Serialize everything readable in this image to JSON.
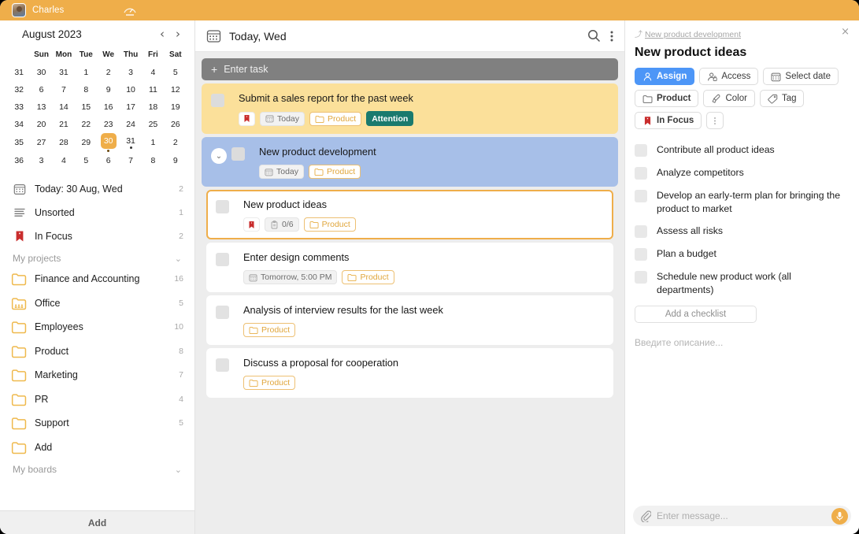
{
  "topbar": {
    "user_name": "Charles",
    "gauge_icon": "gauge-icon",
    "bg_color": "#efae4a"
  },
  "calendar": {
    "title": "August 2023",
    "prev_label": "‹",
    "next_label": "›",
    "weekday_headers": [
      "",
      "Sun",
      "Mon",
      "Tue",
      "We",
      "Thu",
      "Fri",
      "Sat"
    ],
    "weeks": [
      {
        "num": "31",
        "days": [
          {
            "d": "30",
            "dim": true
          },
          {
            "d": "31",
            "dim": true
          },
          {
            "d": "1"
          },
          {
            "d": "2"
          },
          {
            "d": "3"
          },
          {
            "d": "4",
            "we": true
          },
          {
            "d": "5",
            "we": true
          }
        ]
      },
      {
        "num": "32",
        "days": [
          {
            "d": "6"
          },
          {
            "d": "7"
          },
          {
            "d": "8"
          },
          {
            "d": "9"
          },
          {
            "d": "10"
          },
          {
            "d": "11",
            "we": true
          },
          {
            "d": "12",
            "we": true
          }
        ]
      },
      {
        "num": "33",
        "days": [
          {
            "d": "13"
          },
          {
            "d": "14"
          },
          {
            "d": "15"
          },
          {
            "d": "16"
          },
          {
            "d": "17"
          },
          {
            "d": "18",
            "we": true
          },
          {
            "d": "19",
            "we": true
          }
        ]
      },
      {
        "num": "34",
        "days": [
          {
            "d": "20"
          },
          {
            "d": "21"
          },
          {
            "d": "22"
          },
          {
            "d": "23"
          },
          {
            "d": "24"
          },
          {
            "d": "25",
            "we": true
          },
          {
            "d": "26",
            "we": true
          }
        ]
      },
      {
        "num": "35",
        "days": [
          {
            "d": "27"
          },
          {
            "d": "28"
          },
          {
            "d": "29"
          },
          {
            "d": "30",
            "sel": true,
            "dot": true
          },
          {
            "d": "31",
            "dot": true
          },
          {
            "d": "1",
            "dim": true
          },
          {
            "d": "2",
            "dim": true
          }
        ]
      },
      {
        "num": "36",
        "days": [
          {
            "d": "3",
            "dim": true
          },
          {
            "d": "4",
            "dim": true
          },
          {
            "d": "5",
            "dim": true
          },
          {
            "d": "6",
            "dim": true
          },
          {
            "d": "7",
            "dim": true
          },
          {
            "d": "8",
            "dim": true
          },
          {
            "d": "9",
            "dim": true
          }
        ]
      }
    ],
    "selected_day_color": "#efae4a",
    "weeknum_color": "#3d9e3d",
    "weekend_color": "#e04545"
  },
  "sidebar": {
    "nav": [
      {
        "icon": "calendar-icon",
        "label": "Today: 30 Aug, Wed",
        "count": "2"
      },
      {
        "icon": "lines-icon",
        "label": "Unsorted",
        "count": "1"
      },
      {
        "icon": "bookmark-icon",
        "label": "In Focus",
        "count": "2"
      }
    ],
    "projects_group": {
      "title": "My projects",
      "chevron": "⌄"
    },
    "projects": [
      {
        "icon": "folder-icon",
        "label": "Finance and Accounting",
        "count": "16"
      },
      {
        "icon": "folder-people-icon",
        "label": "Office",
        "count": "5"
      },
      {
        "icon": "folder-icon",
        "label": "Employees",
        "count": "10"
      },
      {
        "icon": "folder-icon",
        "label": "Product",
        "count": "8"
      },
      {
        "icon": "folder-icon",
        "label": "Marketing",
        "count": "7"
      },
      {
        "icon": "folder-icon",
        "label": "PR",
        "count": "4"
      },
      {
        "icon": "folder-icon",
        "label": "Support",
        "count": "5"
      },
      {
        "icon": "folder-icon",
        "label": "Add",
        "count": ""
      }
    ],
    "boards_group": {
      "title": "My boards",
      "chevron": "⌄"
    },
    "footer_add": "Add"
  },
  "center": {
    "header": {
      "icon": "calendar-icon",
      "title": "Today, Wed",
      "search_icon": "search-icon",
      "menu_icon": "more-vertical-icon"
    },
    "enter_task": {
      "plus": "+",
      "label": "Enter task"
    },
    "tasks": [
      {
        "title": "Submit a sales report for the past week",
        "color": "yellow",
        "has_toggle": false,
        "indent": false,
        "selected": false,
        "chips": [
          {
            "type": "flag",
            "icon": "bookmark-icon"
          },
          {
            "type": "plain",
            "icon": "calendar-icon",
            "label": "Today"
          },
          {
            "type": "proj",
            "icon": "folder-icon",
            "label": "Product"
          },
          {
            "type": "attention",
            "label": "Attention"
          }
        ]
      },
      {
        "title": "New product development",
        "color": "blue",
        "has_toggle": true,
        "indent": false,
        "selected": false,
        "chips": [
          {
            "type": "plain",
            "icon": "calendar-icon",
            "label": "Today"
          },
          {
            "type": "proj",
            "icon": "folder-icon",
            "label": "Product"
          }
        ]
      },
      {
        "title": "New product ideas",
        "color": "white",
        "has_toggle": false,
        "indent": true,
        "selected": true,
        "chips": [
          {
            "type": "flag",
            "icon": "bookmark-icon"
          },
          {
            "type": "plain",
            "icon": "clipboard-icon",
            "label": "0/6"
          },
          {
            "type": "proj",
            "icon": "folder-icon",
            "label": "Product"
          }
        ]
      },
      {
        "title": "Enter design comments",
        "color": "white",
        "has_toggle": false,
        "indent": true,
        "selected": false,
        "chips": [
          {
            "type": "plain",
            "icon": "calendar-icon",
            "label": "Tomorrow, 5:00 PM"
          },
          {
            "type": "proj",
            "icon": "folder-icon",
            "label": "Product"
          }
        ]
      },
      {
        "title": "Analysis of interview results for the last week",
        "color": "white",
        "has_toggle": false,
        "indent": true,
        "selected": false,
        "chips": [
          {
            "type": "proj",
            "icon": "folder-icon",
            "label": "Product"
          }
        ]
      },
      {
        "title": "Discuss a proposal for cooperation",
        "color": "white",
        "has_toggle": false,
        "indent": true,
        "selected": false,
        "chips": [
          {
            "type": "proj",
            "icon": "folder-icon",
            "label": "Product"
          }
        ]
      }
    ]
  },
  "detail": {
    "breadcrumb": "New product development",
    "breadcrumb_arrow": "⤴",
    "close_label": "×",
    "title": "New product ideas",
    "buttons_row1": [
      {
        "label": "Assign",
        "icon": "person-icon",
        "active": true
      },
      {
        "label": "Access",
        "icon": "lock-person-icon",
        "active": false
      },
      {
        "label": "Select date",
        "icon": "calendar-icon",
        "active": false
      }
    ],
    "buttons_row2": [
      {
        "label": "Product",
        "icon": "folder-icon",
        "active": false,
        "bold": true
      },
      {
        "label": "Color",
        "icon": "brush-icon",
        "active": false
      },
      {
        "label": "Tag",
        "icon": "tag-icon",
        "active": false
      }
    ],
    "buttons_row3": [
      {
        "label": "In Focus",
        "icon": "bookmark-icon",
        "active": false,
        "bold": true
      },
      {
        "label": "⋮",
        "icon": "more-vertical-icon",
        "active": false,
        "dots": true
      }
    ],
    "checklist": [
      {
        "label": "Contribute all product ideas",
        "checked": false
      },
      {
        "label": "Analyze competitors",
        "checked": false
      },
      {
        "label": "Develop an early-term plan for bringing the product to market",
        "checked": false
      },
      {
        "label": "Assess all risks",
        "checked": false
      },
      {
        "label": "Plan a budget",
        "checked": false
      },
      {
        "label": "Schedule new product work (all departments)",
        "checked": false
      }
    ],
    "add_checklist": "Add a checklist",
    "description_placeholder": "Введите описание...",
    "message": {
      "placeholder": "Enter message...",
      "value": "",
      "attach_icon": "paperclip-icon",
      "mic_icon": "microphone-icon"
    },
    "accent_blue": "#4d96f7"
  }
}
